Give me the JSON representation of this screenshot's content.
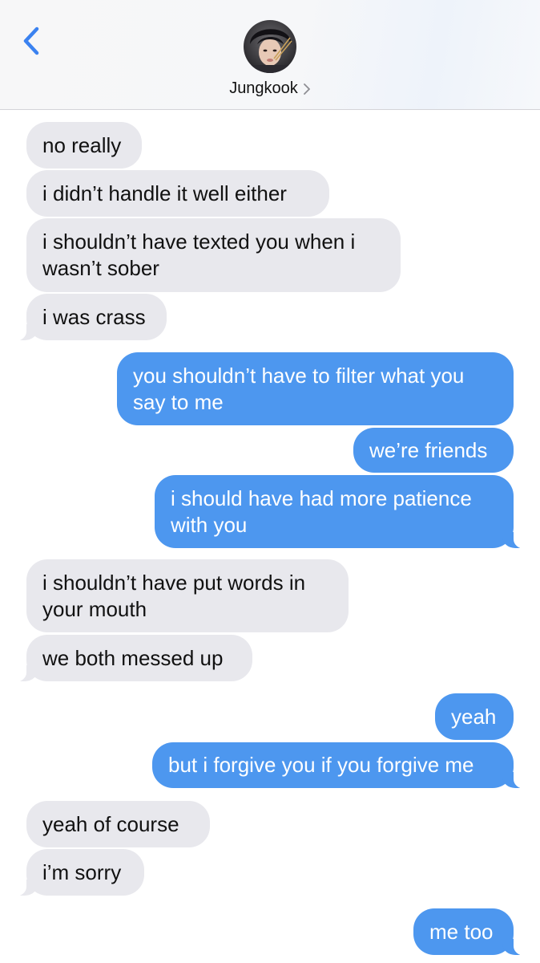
{
  "header": {
    "contact_name": "Jungkook",
    "back_icon": "chevron-left-icon",
    "disclosure_icon": "chevron-right-icon",
    "accent_color": "#3b82f0"
  },
  "messages": [
    {
      "direction": "incoming",
      "text": "no really"
    },
    {
      "direction": "incoming",
      "text": "i didn’t handle it well either"
    },
    {
      "direction": "incoming",
      "text": "i shouldn’t have texted you when i"
    },
    {
      "direction": "incoming",
      "text": "wasn’t sober"
    },
    {
      "direction": "incoming",
      "text": "i was crass"
    },
    {
      "direction": "outgoing",
      "text": "you shouldn’t have to filter what you"
    },
    {
      "direction": "outgoing",
      "text": "say to me"
    },
    {
      "direction": "outgoing",
      "text": "we’re friends"
    },
    {
      "direction": "outgoing",
      "text": "i should have had more patience"
    },
    {
      "direction": "outgoing",
      "text": "with you"
    },
    {
      "direction": "incoming",
      "text": "i shouldn’t have put words in"
    },
    {
      "direction": "incoming",
      "text": "your mouth"
    },
    {
      "direction": "incoming",
      "text": "we both messed up"
    },
    {
      "direction": "outgoing",
      "text": "yeah"
    },
    {
      "direction": "outgoing",
      "text": "but i forgive you if you forgive me"
    },
    {
      "direction": "incoming",
      "text": "yeah of course"
    },
    {
      "direction": "incoming",
      "text": "i’m sorry"
    },
    {
      "direction": "outgoing",
      "text": "me too"
    }
  ],
  "colors": {
    "incoming_bubble": "#e8e8ed",
    "outgoing_bubble": "#4d97ef",
    "incoming_text": "#111111",
    "outgoing_text": "#ffffff"
  }
}
